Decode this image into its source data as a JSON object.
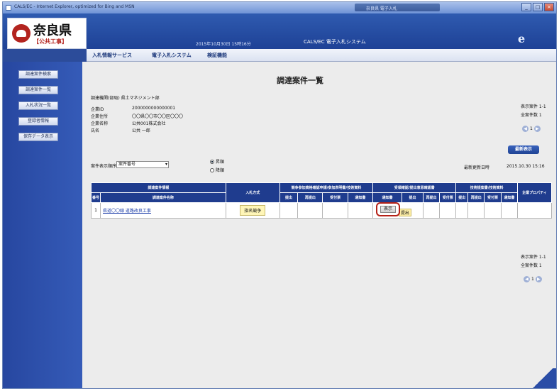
{
  "window": {
    "title": "CALS/EC - Internet Explorer, optimized for Bing and MSN",
    "taskbar_text": "奈良県 電子入札",
    "buttons": [
      "_",
      "□",
      "×"
    ]
  },
  "header": {
    "prefecture": "奈良県",
    "subtitle": "【公共工事】",
    "datetime": "2015年10月30日 15時16分",
    "system_name": "CALS/EC 電子入札システム",
    "ie_icon": "e"
  },
  "menubar": [
    "入札情報サービス",
    "電子入札システム",
    "検証機能"
  ],
  "sidebar": {
    "items": [
      "調達案件検索",
      "調達案件一覧",
      "入札状況一覧",
      "登録者情報",
      "保存データ表示"
    ]
  },
  "main": {
    "page_title": "調達案件一覧",
    "org": "調達機関(部局)  県土マネジメント部",
    "company": {
      "id_label": "企業ID",
      "id_value": "2000000000000001",
      "addr_label": "企業住所",
      "addr_value": "〇〇県〇〇市〇〇区〇〇〇",
      "name_label": "企業名称",
      "name_value": "公共001株式会社",
      "person_label": "氏名",
      "person_value": "公共 一郎"
    },
    "display_range_top": "表示案件 1-1",
    "total_top": "全案件数 1",
    "page_prev": "◀",
    "page_current": "1",
    "page_next": "▶",
    "refresh_button": "最新表示",
    "last_update_label": "最新更新日時",
    "last_update_value": "2015.10.30 15:16",
    "sort_label": "案件表示順序",
    "sort_value": "案件番号",
    "radio_asc": "昇順",
    "radio_desc": "降順",
    "display_range_bottom": "表示案件 1-1",
    "total_bottom": "全案件数 1"
  },
  "table": {
    "headers": {
      "case_info": "調達案件情報",
      "no": "番号",
      "case_name": "調達案件名称",
      "bid_method": "入札方式",
      "group1": "競争参加資格確認申請/参加表明書/技術資料",
      "group2": "受領確認/提出意思確認書",
      "group3": "技術提案書/技術資料",
      "group4": "企業プロパティ",
      "sub": [
        "提出",
        "再提出",
        "受付票",
        "通知書",
        "通知書",
        "提出",
        "再提出",
        "受付票",
        "提出",
        "再提出",
        "受付票",
        "通知書"
      ]
    },
    "rows": [
      {
        "no": "1",
        "case_name": "県道〇〇線 道路改良工事",
        "bid_method": "指名競争",
        "show_button": "表示",
        "submit_button": "提出"
      }
    ]
  }
}
